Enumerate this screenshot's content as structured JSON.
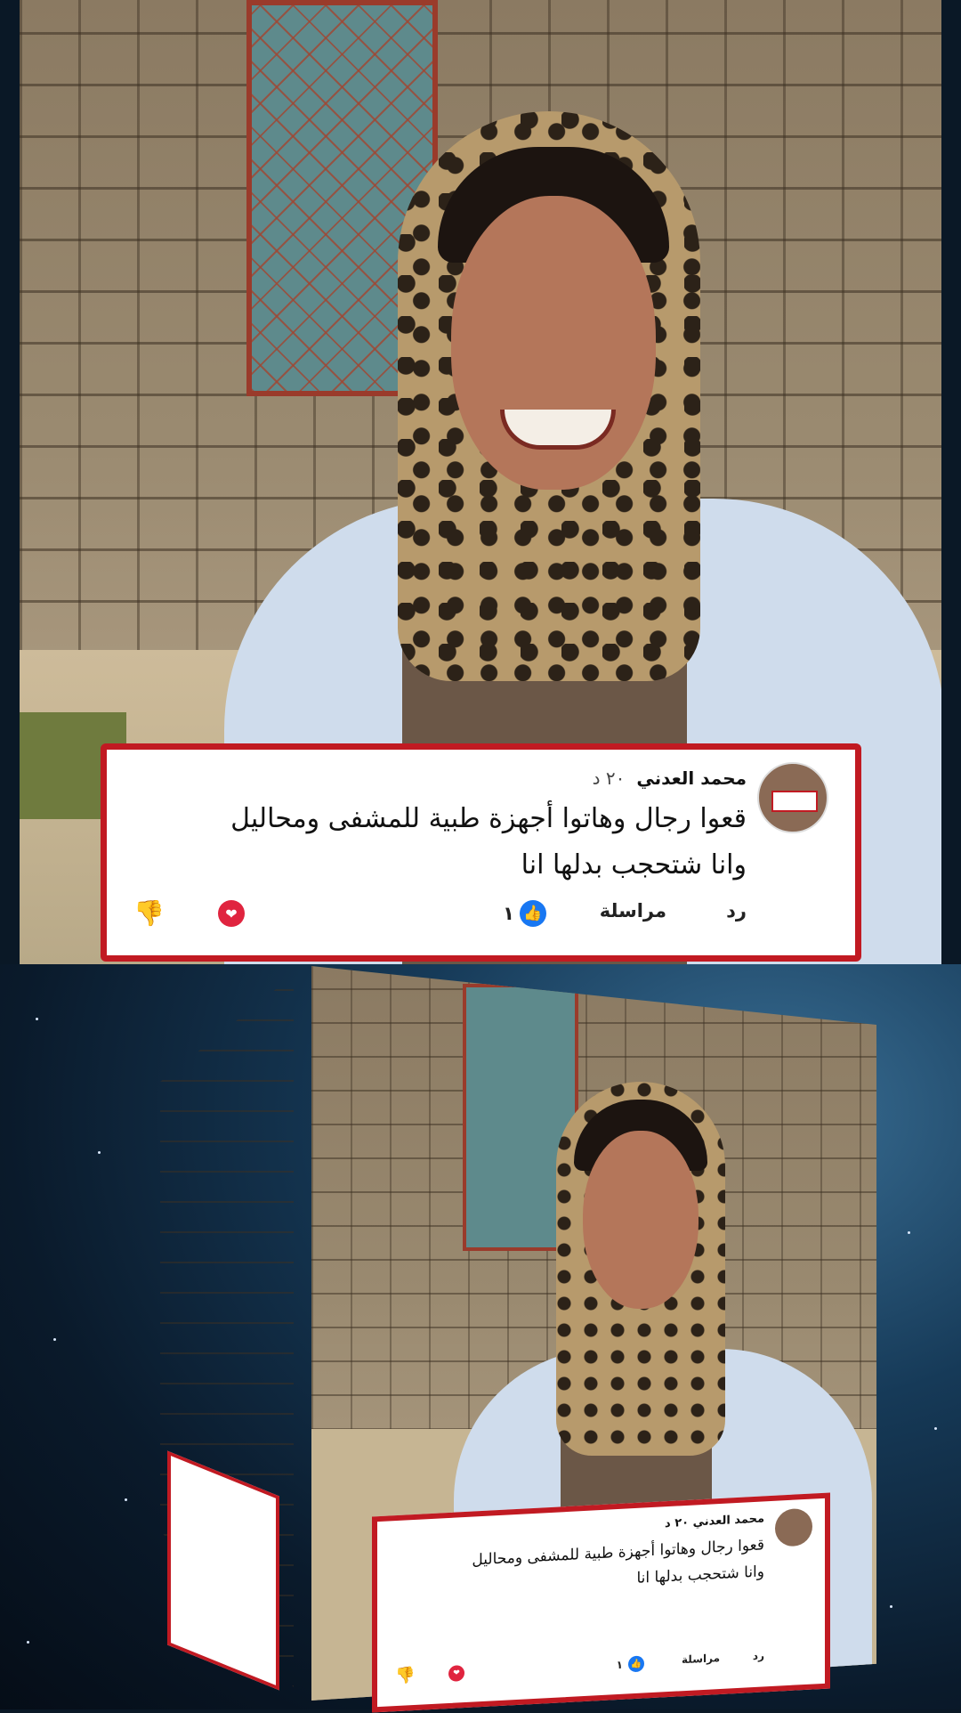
{
  "comment": {
    "author": "محمد العدني",
    "time": "٢٠ د",
    "text_line1": "قعوا رجال وهاتوا أجهزة طبية للمشفى ومحاليل",
    "text_line2": "وانا شتحجب بدلها انا",
    "reply_label": "رد",
    "message_label": "مراسلة",
    "like_count": "١"
  },
  "icons": {
    "like": "thumbs-up-icon",
    "love": "heart-icon",
    "dislike": "thumbs-down-icon"
  },
  "colors": {
    "card_border": "#c11a22",
    "like_blue": "#1877f2",
    "heart_red": "#e0243f"
  }
}
